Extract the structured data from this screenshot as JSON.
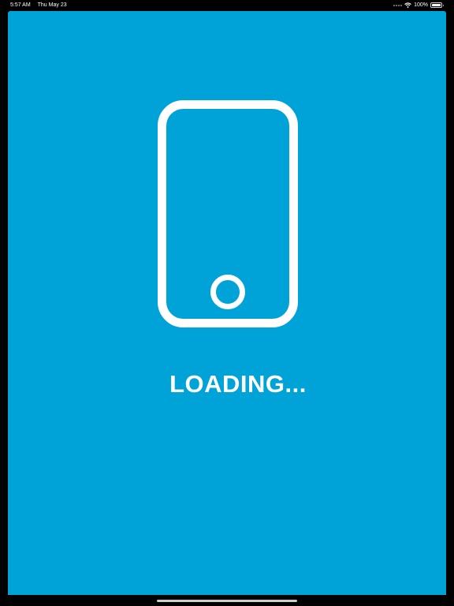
{
  "status_bar": {
    "time": "5:57 AM",
    "date": "Thu May 23",
    "battery_percent": "100%",
    "battery_level": 1.0,
    "wifi_icon": "wifi-icon",
    "battery_icon": "battery-icon",
    "cellular_icon": "cellular-dots-icon"
  },
  "splash": {
    "icon": "smartphone-icon",
    "loading_label": "LOADING..."
  },
  "colors": {
    "screen_background": "#00a3d8",
    "icon_color": "#ffffff",
    "text_color": "#ffffff",
    "bezel": "#000000"
  }
}
